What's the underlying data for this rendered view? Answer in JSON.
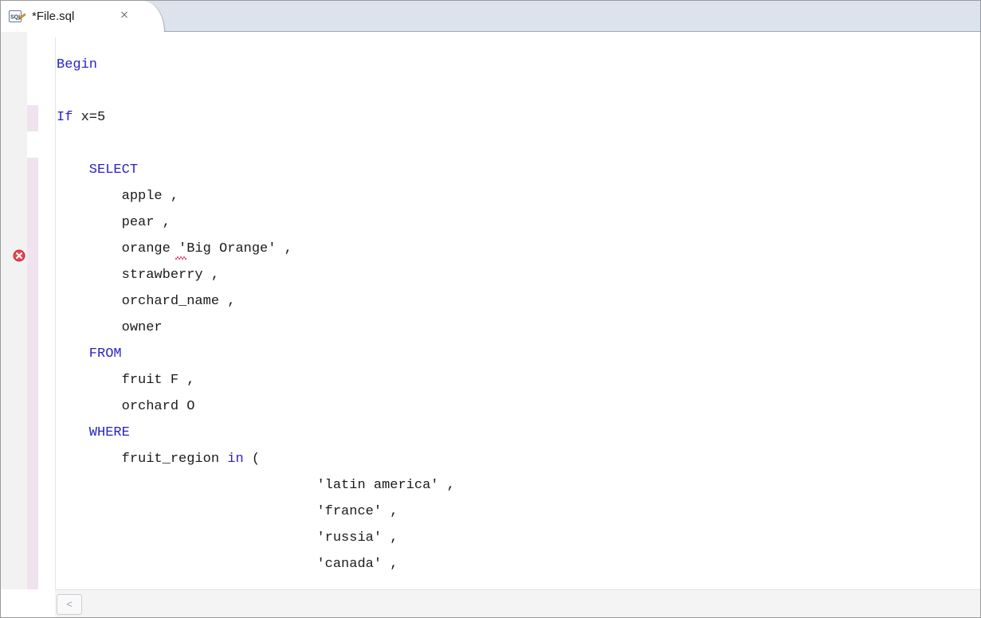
{
  "tab": {
    "title": "*File.sql",
    "icon": "sql-file-icon",
    "close_glyph": "⨯"
  },
  "editor": {
    "lines": [
      {
        "parts": [
          {
            "t": "Begin",
            "k": true
          }
        ]
      },
      {
        "parts": []
      },
      {
        "parts": [
          {
            "t": "If",
            "k": true
          },
          {
            "t": " x=5",
            "k": false
          }
        ]
      },
      {
        "parts": []
      },
      {
        "parts": [
          {
            "t": "    SELECT",
            "k": true
          }
        ]
      },
      {
        "parts": [
          {
            "t": "        apple ,",
            "k": false
          }
        ]
      },
      {
        "parts": [
          {
            "t": "        pear ,",
            "k": false
          }
        ]
      },
      {
        "parts": [
          {
            "t": "        orange ",
            "k": false
          },
          {
            "t": "'",
            "k": false,
            "err": true
          },
          {
            "t": "Big Orange' ,",
            "k": false
          }
        ]
      },
      {
        "parts": [
          {
            "t": "        strawberry ,",
            "k": false
          }
        ]
      },
      {
        "parts": [
          {
            "t": "        orchard_name ,",
            "k": false
          }
        ]
      },
      {
        "parts": [
          {
            "t": "        owner",
            "k": false
          }
        ]
      },
      {
        "parts": [
          {
            "t": "    FROM",
            "k": true
          }
        ]
      },
      {
        "parts": [
          {
            "t": "        fruit F ,",
            "k": false
          }
        ]
      },
      {
        "parts": [
          {
            "t": "        orchard O",
            "k": false
          }
        ]
      },
      {
        "parts": [
          {
            "t": "    WHERE",
            "k": true
          }
        ]
      },
      {
        "parts": [
          {
            "t": "        fruit_region ",
            "k": false
          },
          {
            "t": "in",
            "k": true
          },
          {
            "t": " (",
            "k": false
          }
        ]
      },
      {
        "parts": [
          {
            "t": "                                'latin america' ,",
            "k": false
          }
        ]
      },
      {
        "parts": [
          {
            "t": "                                'france' ,",
            "k": false
          }
        ]
      },
      {
        "parts": [
          {
            "t": "                                'russia' ,",
            "k": false
          }
        ]
      },
      {
        "parts": [
          {
            "t": "                                'canada' ,",
            "k": false
          }
        ]
      }
    ],
    "error_line": 8,
    "colors": {
      "keyword": "#2a23c4",
      "error": "#e0204a",
      "change_ruler": "#efe3ef"
    }
  },
  "scrollbar": {
    "left_arrow": "<"
  }
}
